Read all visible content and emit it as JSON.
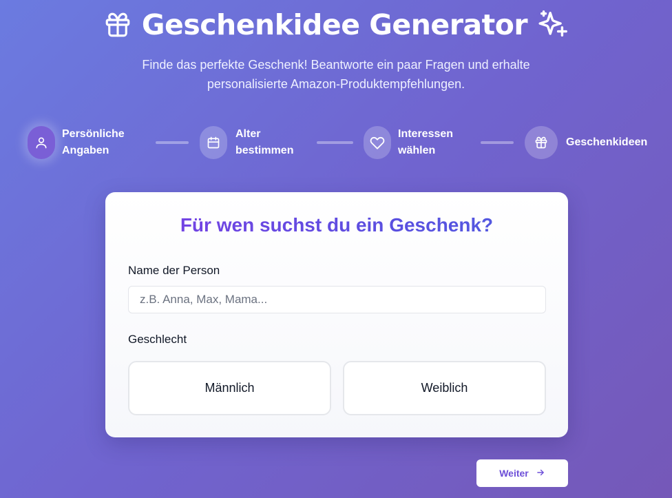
{
  "header": {
    "title": "Geschenkidee Generator",
    "subtitle": "Finde das perfekte Geschenk! Beantworte ein paar Fragen und erhalte personalisierte Amazon-Produktempfehlungen.",
    "left_icon": "gift-icon",
    "right_icon": "sparkles-icon"
  },
  "steps": [
    {
      "label": "Persönliche Angaben",
      "icon": "user-icon",
      "active": true
    },
    {
      "label": "Alter bestimmen",
      "icon": "calendar-icon",
      "active": false
    },
    {
      "label": "Interessen wählen",
      "icon": "heart-icon",
      "active": false
    },
    {
      "label": "Geschenkideen",
      "icon": "gift-icon",
      "active": false
    }
  ],
  "form": {
    "title": "Für wen suchst du ein Geschenk?",
    "name_label": "Name der Person",
    "name_value": "",
    "name_placeholder": "z.B. Anna, Max, Mama...",
    "gender_label": "Geschlecht",
    "gender_options": [
      "Männlich",
      "Weiblich"
    ]
  },
  "next_button": {
    "label": "Weiter",
    "icon": "arrow-right-icon"
  },
  "colors": {
    "accent": "#7b3fe4",
    "accent_secondary": "#4f5ee0",
    "background_start": "#6b7be0",
    "background_end": "#7558b8"
  }
}
